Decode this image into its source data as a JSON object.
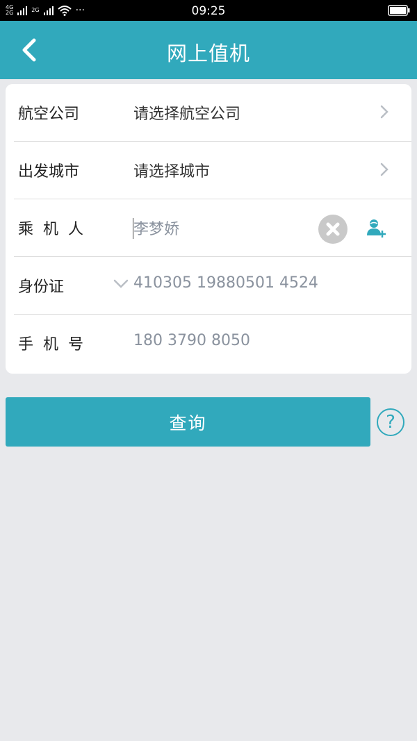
{
  "status_bar": {
    "time": "09:25",
    "network_top": "4G",
    "network_bottom": "2G",
    "network2": "2G",
    "more": "···"
  },
  "header": {
    "title": "网上值机"
  },
  "form": {
    "airline": {
      "label": "航空公司",
      "value": "请选择航空公司"
    },
    "city": {
      "label": "出发城市",
      "value": "请选择城市"
    },
    "passenger": {
      "label": "乘机人",
      "placeholder": "李梦娇"
    },
    "id_card": {
      "label": "身份证",
      "placeholder": "410305 19880501 4524"
    },
    "phone": {
      "label": "手机号",
      "placeholder": "180 3790 8050"
    }
  },
  "actions": {
    "query_label": "查询",
    "help_label": "?"
  },
  "colors": {
    "primary": "#31a9bc",
    "background": "#e8e9ec"
  }
}
